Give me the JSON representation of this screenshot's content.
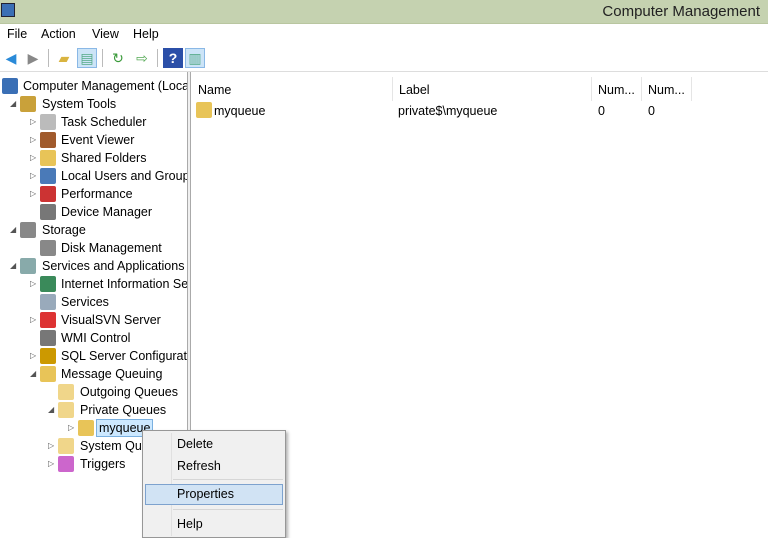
{
  "window": {
    "title": "Computer Management"
  },
  "menubar": [
    "File",
    "Action",
    "View",
    "Help"
  ],
  "toolbar": [
    {
      "icon": "back-arrow-icon"
    },
    {
      "icon": "forward-arrow-icon"
    },
    {
      "icon": "up-folder-icon"
    },
    {
      "icon": "show-hide-console-tree-icon",
      "active": true
    },
    {
      "icon": "refresh-icon"
    },
    {
      "icon": "export-list-icon"
    },
    {
      "icon": "help-icon"
    },
    {
      "icon": "show-hide-action-pane-icon",
      "active": true
    }
  ],
  "tree": [
    {
      "label": "Computer Management (Local",
      "level": 0,
      "exp": "",
      "icon": "computer-management-icon",
      "color": "#3a6fb5"
    },
    {
      "label": "System Tools",
      "level": 1,
      "exp": "open",
      "icon": "tools-icon",
      "color": "#c9a13a"
    },
    {
      "label": "Task Scheduler",
      "level": 2,
      "exp": "closed",
      "icon": "clock-icon",
      "color": "#bbb"
    },
    {
      "label": "Event Viewer",
      "level": 2,
      "exp": "closed",
      "icon": "event-viewer-icon",
      "color": "#a05a2c"
    },
    {
      "label": "Shared Folders",
      "level": 2,
      "exp": "closed",
      "icon": "shared-folder-icon",
      "color": "#e8c458"
    },
    {
      "label": "Local Users and Groups",
      "level": 2,
      "exp": "closed",
      "icon": "users-icon",
      "color": "#4a7ab8"
    },
    {
      "label": "Performance",
      "level": 2,
      "exp": "closed",
      "icon": "performance-icon",
      "color": "#c33"
    },
    {
      "label": "Device Manager",
      "level": 2,
      "exp": "",
      "icon": "device-manager-icon",
      "color": "#777"
    },
    {
      "label": "Storage",
      "level": 1,
      "exp": "open",
      "icon": "storage-icon",
      "color": "#888"
    },
    {
      "label": "Disk Management",
      "level": 2,
      "exp": "",
      "icon": "disk-icon",
      "color": "#888"
    },
    {
      "label": "Services and Applications",
      "level": 1,
      "exp": "open",
      "icon": "services-apps-icon",
      "color": "#8aa"
    },
    {
      "label": "Internet Information Ser",
      "level": 2,
      "exp": "closed",
      "icon": "iis-icon",
      "color": "#3a8a5a"
    },
    {
      "label": "Services",
      "level": 2,
      "exp": "",
      "icon": "gear-icon",
      "color": "#9ab"
    },
    {
      "label": "VisualSVN Server",
      "level": 2,
      "exp": "closed",
      "icon": "visualsvn-icon",
      "color": "#d33"
    },
    {
      "label": "WMI Control",
      "level": 2,
      "exp": "",
      "icon": "wmi-icon",
      "color": "#777"
    },
    {
      "label": "SQL Server Configuratic",
      "level": 2,
      "exp": "closed",
      "icon": "sql-server-icon",
      "color": "#c90"
    },
    {
      "label": "Message Queuing",
      "level": 2,
      "exp": "open",
      "icon": "message-queuing-icon",
      "color": "#e8c458"
    },
    {
      "label": "Outgoing Queues",
      "level": 3,
      "exp": "",
      "icon": "folder-icon",
      "color": "#f0d68a"
    },
    {
      "label": "Private Queues",
      "level": 3,
      "exp": "open",
      "icon": "folder-icon",
      "color": "#f0d68a"
    },
    {
      "label": "myqueue",
      "level": 4,
      "exp": "closed",
      "icon": "queue-icon",
      "color": "#e8c458",
      "selected": true
    },
    {
      "label": "System Que",
      "level": 3,
      "exp": "closed",
      "icon": "folder-icon",
      "color": "#f0d68a"
    },
    {
      "label": "Triggers",
      "level": 3,
      "exp": "closed",
      "icon": "triggers-icon",
      "color": "#c6c"
    }
  ],
  "list": {
    "columns": [
      "Name",
      "Label",
      "Num...",
      "Num..."
    ],
    "rows": [
      {
        "name": "myqueue",
        "label": "private$\\myqueue",
        "num1": "0",
        "num2": "0"
      }
    ]
  },
  "context_menu": {
    "items": [
      "Delete",
      "Refresh",
      "Properties",
      "Help"
    ],
    "highlighted": "Properties"
  }
}
